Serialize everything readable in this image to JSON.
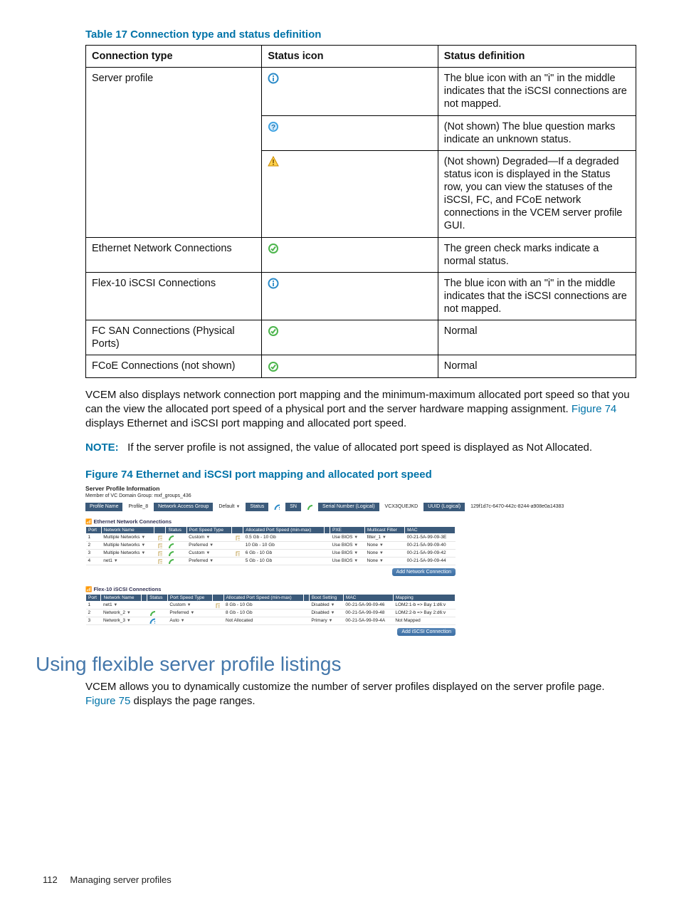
{
  "table17": {
    "caption": "Table 17 Connection type and status definition",
    "headers": [
      "Connection type",
      "Status icon",
      "Status definition"
    ],
    "rows": [
      {
        "type": "Server profile",
        "icon": "info",
        "def": "The blue icon with an \"i\" in the middle indicates that the iSCSI connections are not mapped."
      },
      {
        "type": "",
        "icon": "question",
        "def": "(Not shown) The blue question marks indicate an unknown status."
      },
      {
        "type": "",
        "icon": "warning",
        "def": "(Not shown) Degraded—If a degraded status icon is displayed in the Status row, you can view the statuses of the iSCSI, FC, and FCoE network connections in the VCEM server profile GUI."
      },
      {
        "type": "Ethernet Network Connections",
        "icon": "check",
        "def": "The green check marks indicate a normal status."
      },
      {
        "type": "Flex-10 iSCSI Connections",
        "icon": "info",
        "def": "The blue icon with an \"i\" in the middle indicates that the iSCSI connections are not mapped."
      },
      {
        "type": "FC SAN Connections (Physical Ports)",
        "icon": "check",
        "def": "Normal"
      },
      {
        "type": "FCoE Connections (not shown)",
        "icon": "check",
        "def": "Normal"
      }
    ]
  },
  "para1_pre": "VCEM also displays network connection port mapping and the minimum-maximum allocated port speed so that you can the view the allocated port speed  of a physical port and the server hardware mapping assignment. ",
  "para1_link": "Figure 74",
  "para1_post": " displays Ethernet and iSCSI port mapping and allocated port speed.",
  "note_label": "NOTE:   ",
  "note_text": "If the server profile is not assigned, the value of allocated port speed is displayed as Not Allocated.",
  "fig74_caption": "Figure 74 Ethernet and iSCSI port mapping and allocated port speed",
  "mini": {
    "title": "Server Profile Information",
    "subtitle": "Member of VC Domain Group: mxf_groups_436",
    "bar": {
      "profile_name_h": "Profile Name",
      "profile_name": "Profile_8",
      "nag_h": "Network Access Group",
      "nag": "Default",
      "status_h": "Status",
      "sn_h": "SN",
      "sn": "",
      "serial_h": "Serial Number (Logical)",
      "serial": "VCX3QUEJKD",
      "uuid_h": "UUID (Logical)",
      "uuid": "129f1d7c-6470-442c-8244-a908e0a14383"
    },
    "ethernet": {
      "title": "Ethernet Network Connections",
      "headers": [
        "Port",
        "Network Name",
        "",
        "Status",
        "Port Speed Type",
        "",
        "Allocated Port Speed (min-max)",
        "",
        "PXE",
        "Multicast Filter",
        "MAC"
      ],
      "rows": [
        {
          "port": "1",
          "net": "Multiple Networks",
          "status": "check",
          "pst": "Custom",
          "alloc": "0.5 Gb - 10 Gb",
          "pxe": "Use BIOS",
          "filter": "filter_1",
          "mac": "00-21-5A-99-09-3E"
        },
        {
          "port": "2",
          "net": "Multiple Networks",
          "status": "check",
          "pst": "Preferred",
          "alloc": "10 Gb - 10 Gb",
          "pxe": "Use BIOS",
          "filter": "None",
          "mac": "00-21-5A-99-09-40"
        },
        {
          "port": "3",
          "net": "Multiple Networks",
          "status": "check",
          "pst": "Custom",
          "alloc": "6 Gb - 10 Gb",
          "pxe": "Use BIOS",
          "filter": "None",
          "mac": "00-21-5A-99-09-42"
        },
        {
          "port": "4",
          "net": "net1",
          "status": "check",
          "pst": "Preferred",
          "alloc": "5 Gb - 10 Gb",
          "pxe": "Use BIOS",
          "filter": "None",
          "mac": "00-21-5A-99-09-44"
        }
      ],
      "btn": "Add Network Connection"
    },
    "iscsi": {
      "title": "Flex-10 iSCSI Connections",
      "headers": [
        "Port",
        "Network Name",
        "",
        "Status",
        "Port Speed Type",
        "",
        "Allocated Port Speed (min-max)",
        "",
        "Boot Setting",
        "MAC",
        "Mapping"
      ],
      "rows": [
        {
          "port": "1",
          "net": "net1",
          "status": "blank",
          "pst": "Custom",
          "alloc": "8 Gb - 10 Gb",
          "boot": "Disabled",
          "mac": "00-21-5A-99-09-46",
          "map": "LOM2:1-b => Bay 1:d6:v"
        },
        {
          "port": "2",
          "net": "Network_2",
          "status": "check",
          "pst": "Preferred",
          "alloc": "8 Gb - 10 Gb",
          "boot": "Disabled",
          "mac": "00-21-5A-99-09-48",
          "map": "LOM2:2-b => Bay 2:d6:v"
        },
        {
          "port": "3",
          "net": "Network_3",
          "status": "info",
          "pst": "Auto",
          "alloc": "Not Allocated",
          "boot": "Primary",
          "mac": "00-21-5A-99-09-4A",
          "map": "Not Mapped"
        }
      ],
      "btn": "Add iSCSI Connection"
    }
  },
  "section_heading": "Using flexible server profile listings",
  "para2_pre": "VCEM allows you to dynamically customize the number of server profiles displayed on the server profile page. ",
  "para2_link": "Figure 75",
  "para2_post": " displays the page ranges.",
  "footer": {
    "page": "112",
    "chapter": "Managing server profiles"
  }
}
